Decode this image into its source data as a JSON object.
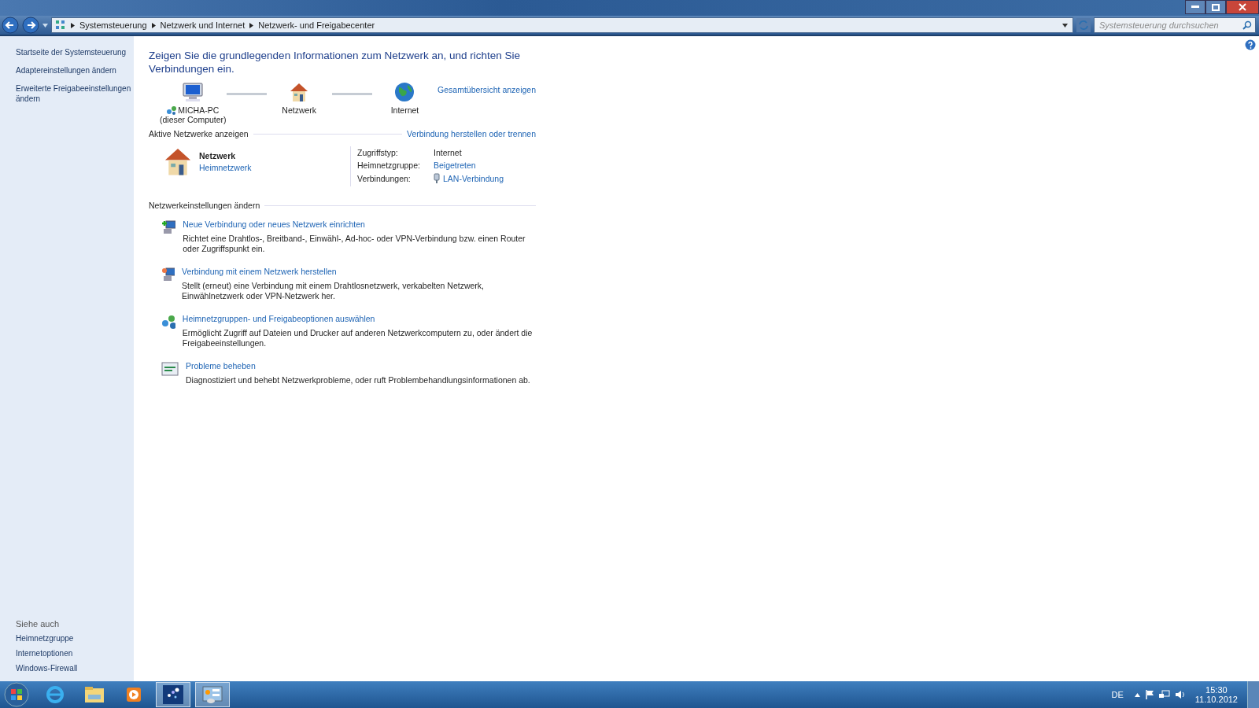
{
  "address_bar": {
    "breadcrumbs": [
      "Systemsteuerung",
      "Netzwerk und Internet",
      "Netzwerk- und Freigabecenter"
    ],
    "search": {
      "placeholder": "Systemsteuerung durchsuchen"
    }
  },
  "sidebar": {
    "links": [
      "Startseite der Systemsteuerung",
      "Adaptereinstellungen ändern",
      "Erweiterte Freigabeeinstellungen ändern"
    ],
    "see_also": {
      "title": "Siehe auch",
      "links": [
        "Heimnetzgruppe",
        "Internetoptionen",
        "Windows-Firewall"
      ]
    }
  },
  "main": {
    "heading": "Zeigen Sie die grundlegenden Informationen zum Netzwerk an, und richten Sie Verbindungen ein.",
    "network_map": {
      "nodes": [
        {
          "kind": "computer",
          "label": "MICHA-PC",
          "sublabel": "(dieser Computer)"
        },
        {
          "kind": "house",
          "label": "Netzwerk"
        },
        {
          "kind": "globe",
          "label": "Internet"
        }
      ],
      "overview_link": "Gesamtübersicht anzeigen"
    },
    "active_networks": {
      "title": "Aktive Netzwerke anzeigen",
      "link": "Verbindung herstellen oder trennen",
      "network": {
        "name": "Netzwerk",
        "type": "Heimnetzwerk"
      },
      "details": [
        {
          "label": "Zugriffstyp:",
          "value": "Internet",
          "kind": "text"
        },
        {
          "label": "Heimnetzgruppe:",
          "value": "Beigetreten",
          "kind": "link"
        },
        {
          "label": "Verbindungen:",
          "value": "LAN-Verbindung",
          "kind": "connection"
        }
      ]
    },
    "settings": {
      "title": "Netzwerkeinstellungen ändern",
      "tasks": [
        {
          "kind": "new",
          "title": "Neue Verbindung oder neues Netzwerk einrichten",
          "description": "Richtet eine Drahtlos-, Breitband-, Einwähl-, Ad-hoc- oder VPN-Verbindung bzw. einen Router oder Zugriffspunkt ein."
        },
        {
          "kind": "connect",
          "title": "Verbindung mit einem Netzwerk herstellen",
          "description": "Stellt (erneut) eine Verbindung mit einem Drahtlosnetzwerk, verkabelten Netzwerk, Einwählnetzwerk oder VPN-Netzwerk her."
        },
        {
          "kind": "homegroup",
          "title": "Heimnetzgruppen- und Freigabeoptionen auswählen",
          "description": "Ermöglicht Zugriff auf Dateien und Drucker auf anderen Netzwerkcomputern zu, oder ändert die Freigabeeinstellungen."
        },
        {
          "kind": "troubleshoot",
          "title": "Probleme beheben",
          "description": "Diagnostiziert und behebt Netzwerkprobleme, oder ruft Problembehandlungsinformationen ab."
        }
      ]
    }
  },
  "taskbar": {
    "buttons": [
      {
        "kind": "browser",
        "selected": false
      },
      {
        "kind": "folder",
        "selected": false
      },
      {
        "kind": "media",
        "selected": false
      },
      {
        "kind": "dots",
        "selected": true
      },
      {
        "kind": "panel",
        "selected": true
      }
    ],
    "tray": {
      "language": "DE",
      "time": "15:30",
      "date": "11.10.2012"
    }
  }
}
